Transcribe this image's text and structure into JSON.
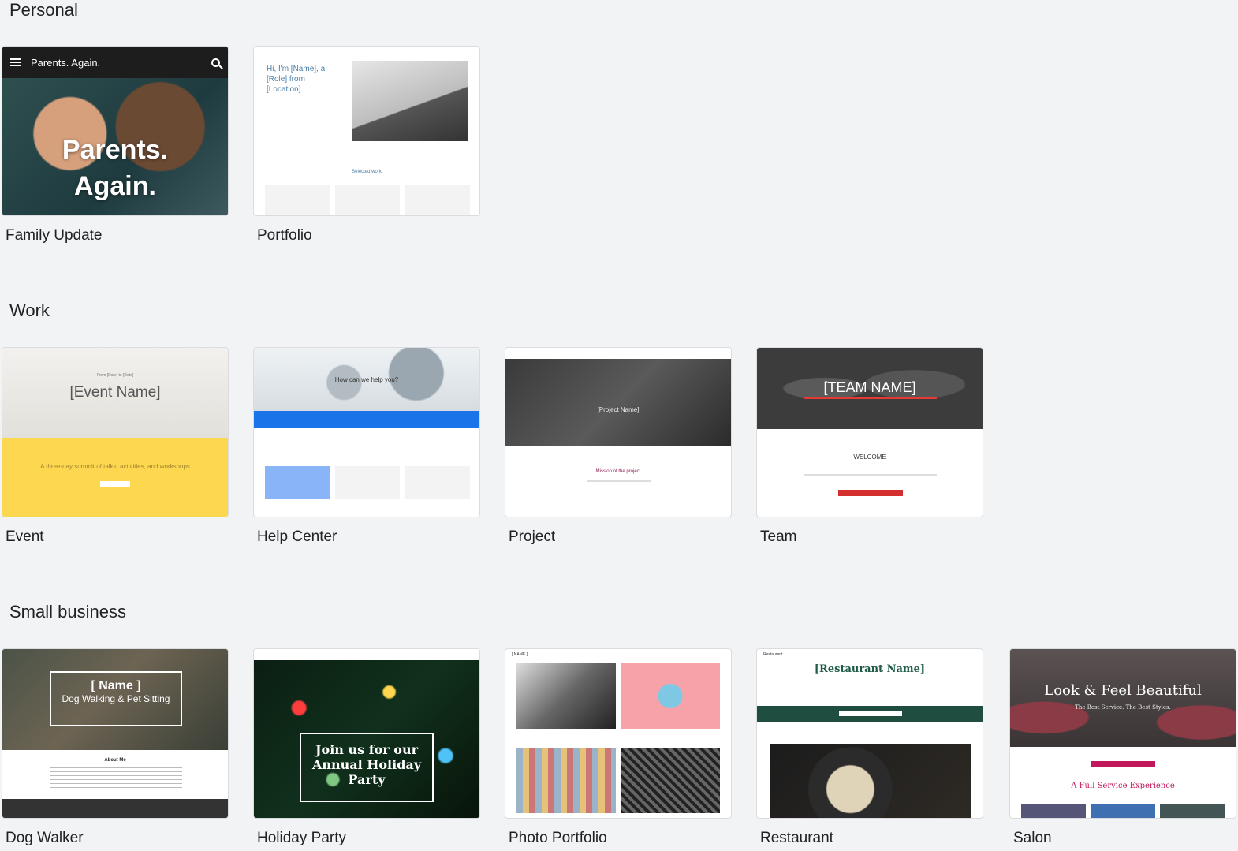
{
  "sections": {
    "personal": "Personal",
    "work": "Work",
    "small_business": "Small business"
  },
  "templates": {
    "family_update": {
      "label": "Family Update",
      "bar_title": "Parents. Again.",
      "hero_line1": "Parents.",
      "hero_line2": "Again."
    },
    "portfolio": {
      "label": "Portfolio",
      "intro": "Hi, I'm [Name], a [Role] from [Location].",
      "selected": "Selected work"
    },
    "event": {
      "label": "Event",
      "event_name": "[Event Name]",
      "date_line": "From [Date] to [Date]",
      "tagline": "A three-day summit of talks, activities, and workshops"
    },
    "help_center": {
      "label": "Help Center",
      "question": "How can we help you?"
    },
    "project": {
      "label": "Project",
      "project_name": "[Project Name]",
      "mission": "Mission of the project"
    },
    "team": {
      "label": "Team",
      "team_name": "[TEAM NAME]",
      "welcome": "WELCOME"
    },
    "dog_walker": {
      "label": "Dog Walker",
      "name": "[ Name ]",
      "service": "Dog Walking & Pet Sitting",
      "about": "About Me"
    },
    "holiday_party": {
      "label": "Holiday Party",
      "headline": "Join us for our Annual Holiday Party"
    },
    "photo_portfolio": {
      "label": "Photo Portfolio",
      "nav_name": "[ NAME ]"
    },
    "restaurant": {
      "label": "Restaurant",
      "restaurant_name": "[Restaurant Name]",
      "nav_title": "Restaurant"
    },
    "salon": {
      "label": "Salon",
      "title": "Look & Feel Beautiful",
      "subtitle": "The Best Service. The Best Styles.",
      "full_service": "A Full Service Experience"
    }
  }
}
